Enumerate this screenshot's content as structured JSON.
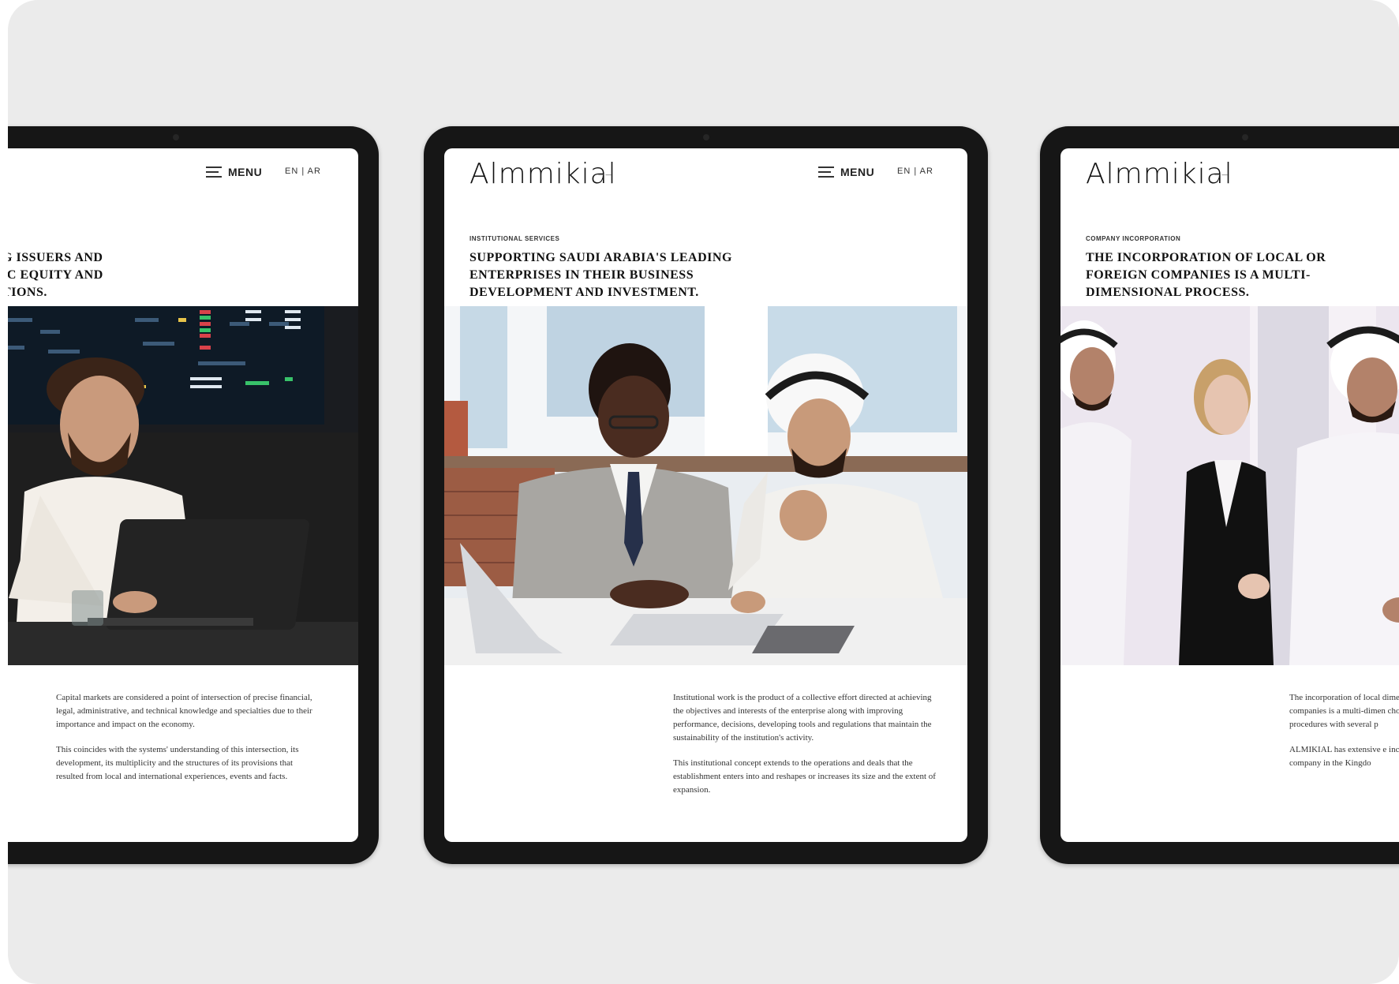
{
  "tablets": [
    {
      "id": "left",
      "menu_label": "MENU",
      "lang": "EN | AR",
      "heading": "NG ISSUERS AND\nLIC EQUITY AND\nCTIONS.",
      "paragraphs": [
        "Capital markets are considered a point of intersection of precise financial, legal, administrative, and technical knowledge and specialties due to their importance and impact on the economy.",
        "This coincides with the systems' understanding of this intersection, its development, its multiplicity and the structures of its provisions that resulted from local and international experiences, events and facts."
      ]
    },
    {
      "id": "middle",
      "logo": "Almmikial",
      "logo_sub": "——",
      "menu_label": "MENU",
      "lang": "EN | AR",
      "eyebrow": "INSTITUTIONAL SERVICES",
      "heading": "SUPPORTING SAUDI ARABIA'S LEADING\nENTERPRISES IN THEIR BUSINESS\nDEVELOPMENT AND INVESTMENT.",
      "paragraphs": [
        "Institutional work is the product of a collective effort directed at achieving the objectives and interests of the enterprise along with improving performance, decisions, developing tools and regulations that maintain the sustainability of the institution's activity.",
        "This institutional concept extends to the operations and deals that the establishment enters into and reshapes or increases its size and the extent of expansion."
      ]
    },
    {
      "id": "right",
      "logo": "Almmikial",
      "logo_sub": "——",
      "eyebrow": "COMPANY INCORPORATION",
      "heading": "THE INCORPORATION OF LOCAL OR\nFOREIGN COMPANIES IS A MULTI-\nDIMENSIONAL PROCESS.",
      "paragraphs": [
        "The incorporation of local dimensional process. The companies is a multi-dimen choosing the legal form of procedures with several p",
        "ALMIKIAL has extensive e incorporating companies, a company in the Kingdo"
      ]
    }
  ]
}
